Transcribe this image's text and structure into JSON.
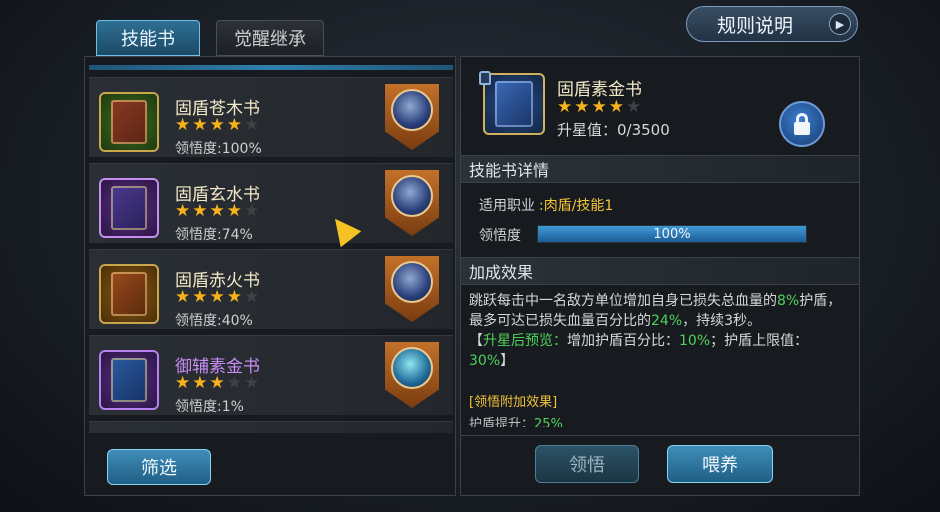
{
  "tabs": [
    {
      "label": "技能书",
      "active": true
    },
    {
      "label": "觉醒继承",
      "active": false
    }
  ],
  "rules_button": {
    "label": "规则说明"
  },
  "book_list": [
    {
      "name": "固盾苍木书",
      "stars": 4,
      "max_stars": 5,
      "comprehension": "领悟度:100%",
      "name_color": "#f3e9c8"
    },
    {
      "name": "固盾玄水书",
      "stars": 4,
      "max_stars": 5,
      "comprehension": "领悟度:74%",
      "name_color": "#f3e9c8"
    },
    {
      "name": "固盾赤火书",
      "stars": 4,
      "max_stars": 5,
      "comprehension": "领悟度:40%",
      "name_color": "#f3e9c8"
    },
    {
      "name": "御辅素金书",
      "stars": 3,
      "max_stars": 5,
      "comprehension": "领悟度:1%",
      "name_color": "#c98df5"
    }
  ],
  "filter_button": {
    "label": "筛选"
  },
  "detail": {
    "name": "固盾素金书",
    "stars": 4,
    "max_stars": 5,
    "upgrade_value": "升星值：0/3500",
    "section_details": "技能书详情",
    "profession_label": "适用职业",
    "profession_value": ":肉盾/技能1",
    "comprehension_label": "领悟度",
    "comprehension_percent": 100,
    "comprehension_text": "100%",
    "section_effects": "加成效果",
    "effect_text_1": "跳跃每击中一名敌方单位增加自身已损失总血量的",
    "effect_val_1": "8%",
    "effect_text_2": "护盾，最多可达已损失血量百分比的",
    "effect_val_2": "24%",
    "effect_text_3": "，持续3秒。",
    "effect_bracket_open": "【",
    "effect_preview_label": "升星后预览：",
    "effect_preview_text_1": "增加护盾百分比：",
    "effect_preview_val_1": "10%",
    "effect_preview_text_2": "；护盾上限值：",
    "effect_preview_val_2": "30%",
    "effect_preview_text_3": "】",
    "extra_title": "[领悟附加效果]",
    "extra_line_label": "护盾提升：",
    "extra_line_value": "25%"
  },
  "comprehend_button": {
    "label": "领悟"
  },
  "feed_button": {
    "label": "喂养"
  },
  "colors": {
    "accent_blue": "#2f7fae",
    "star_gold": "#f6b21c",
    "highlight_green": "#4fd15a",
    "highlight_yellow": "#f2c436"
  }
}
